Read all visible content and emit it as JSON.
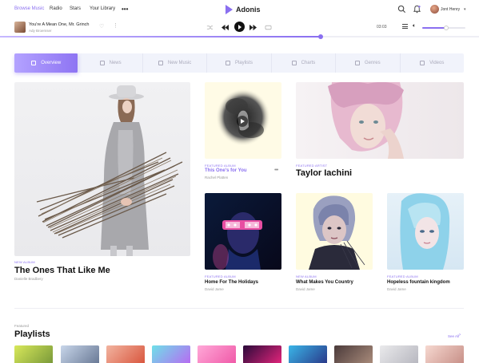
{
  "nav": {
    "links": [
      "Browse Music",
      "Radio",
      "Stars",
      "Your Library"
    ],
    "more": "•••",
    "brand": "Adonis",
    "user_name": "Jont Henry",
    "caret": "▾"
  },
  "player": {
    "title": "You're A Mean One, Mr. Grinch",
    "artist": "Ady Broemser",
    "time": "03:03",
    "progress_fraction": 0.67,
    "volume_fraction": 0.55,
    "icons": {
      "heart": "heart-icon",
      "more": "kebab-icon",
      "shuffle": "shuffle-icon",
      "prev": "previous-icon",
      "play": "play-icon",
      "next": "next-icon",
      "repeat": "repeat-icon",
      "queue": "queue-icon",
      "volume": "volume-icon"
    }
  },
  "tabs": [
    {
      "label": "Overview",
      "active": true
    },
    {
      "label": "News",
      "active": false
    },
    {
      "label": "New Music",
      "active": false
    },
    {
      "label": "Playlists",
      "active": false
    },
    {
      "label": "Charts",
      "active": false
    },
    {
      "label": "Genres",
      "active": false
    },
    {
      "label": "Videos",
      "active": false
    }
  ],
  "featured": {
    "main": {
      "kicker": "NEW ALBUM",
      "title": "The Ones That Like Me",
      "artist": "Danielle Bradbery"
    },
    "album": {
      "kicker": "FEATURED ALBUM",
      "title": "This One's for You",
      "artist": "Rachel Platten"
    },
    "artist": {
      "kicker": "FEATURED ARTIST",
      "title": "Taylor Iachini"
    },
    "small": [
      {
        "kicker": "FEATURED ALBUM",
        "title": "Home For The Holidays",
        "artist": "David Jame"
      },
      {
        "kicker": "NEW ALBUM",
        "title": "What Makes You Country",
        "artist": "David Jame"
      },
      {
        "kicker": "FEATURED ALBUM",
        "title": "Hopeless fountain kingdom",
        "artist": "David Jame"
      }
    ]
  },
  "playlists": {
    "kicker": "Featured",
    "title": "Playlists",
    "see_all": "See All",
    "see_all_arrow": "›"
  },
  "colors": {
    "accent": "#8a6ff0",
    "accent_light": "#b3a2ff",
    "tab_bg": "#f1f3fb"
  }
}
